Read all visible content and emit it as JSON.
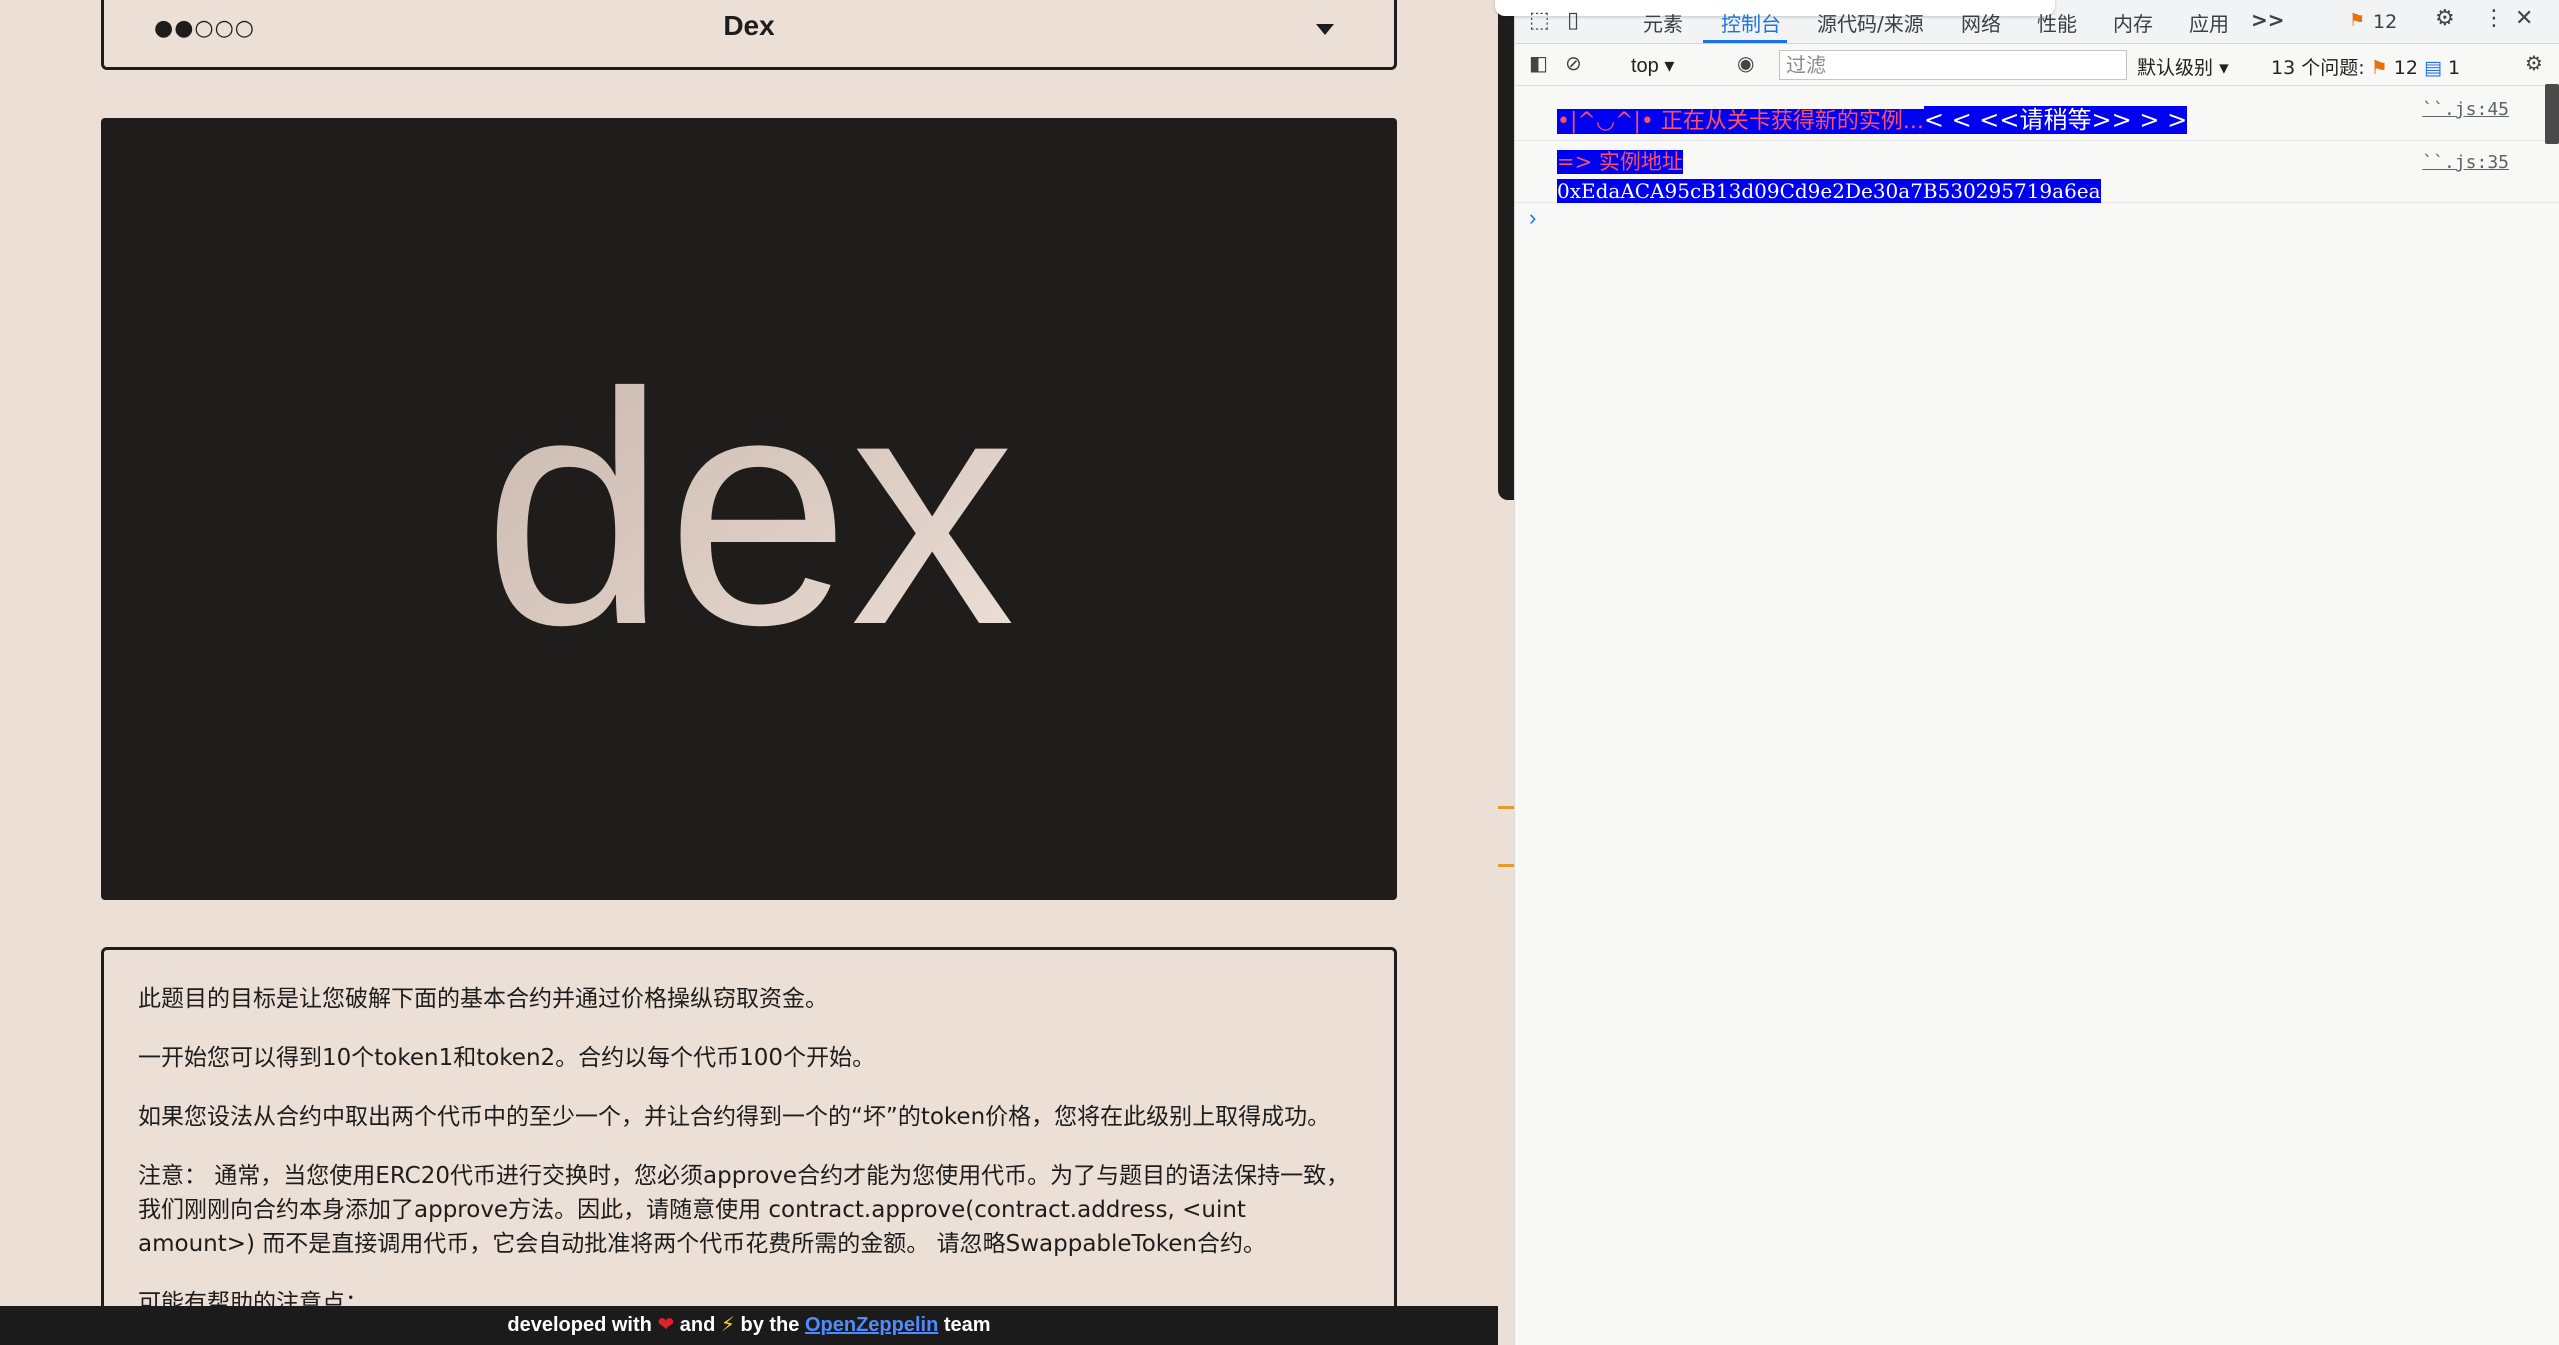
{
  "level": {
    "progress_dots": "●●○○○",
    "title": "Dex"
  },
  "hero": {
    "logo_text": "dex"
  },
  "description": {
    "paragraphs": [
      "此题目的目标是让您破解下面的基本合约并通过价格操纵窃取资金。",
      "一开始您可以得到10个token1和token2。合约以每个代币100个开始。",
      "如果您设法从合约中取出两个代币中的至少一个，并让合约得到一个的“坏”的token价格，您将在此级别上取得成功。",
      "注意： 通常，当您使用ERC20代币进行交换时，您必须approve合约才能为您使用代币。为了与题目的语法保持一致，我们刚刚向合约本身添加了approve方法。因此，请随意使用 contract.approve(contract.address, <uint amount>) 而不是直接调用代币，它会自动批准将两个代币花费所需的金额。 请忽略SwappableToken合约。",
      "可能有帮助的注意点："
    ]
  },
  "footer": {
    "prefix": "developed with",
    "heart": "❤",
    "and": "and",
    "bolt": "⚡",
    "by_the": "by the",
    "link": "OpenZeppelin",
    "suffix": "team"
  },
  "devtools": {
    "tabs": [
      "元素",
      "控制台",
      "源代码/来源",
      "网络",
      "性能",
      "内存",
      "应用"
    ],
    "more_tabs": ">>",
    "issue_badge_count": "12",
    "context": "top",
    "filter_placeholder": "过滤",
    "log_level": "默认级别",
    "issues_summary": "13 个问题:",
    "issues_warn": "12",
    "issues_info": "1",
    "messages": [
      {
        "part1": "•|^◡^|• 正在从关卡获得新的实例...",
        "part2": "< < <<请稍等>> > >",
        "source": "``.js:45"
      },
      {
        "part1": "=> 实例地址",
        "part2": "0xEdaACA95cB13d09Cd9e2De30a7B530295719a6ea",
        "source": "``.js:35"
      }
    ]
  },
  "colors": {
    "page_bg": "#ecdfd6",
    "hero_bg": "#1e1d1b",
    "accent_blue": "#1a73e8",
    "highlight_bg": "#0000f0"
  }
}
